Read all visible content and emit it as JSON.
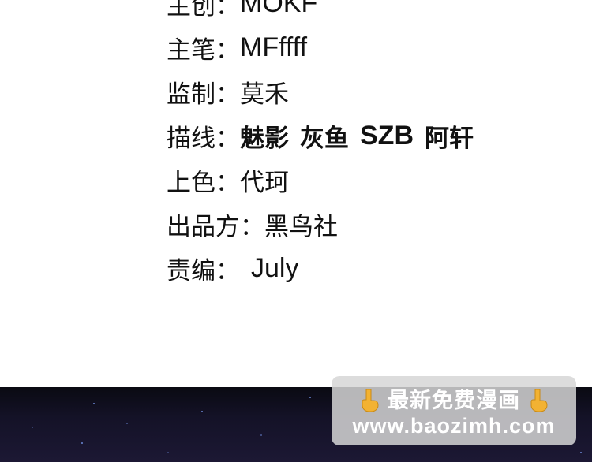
{
  "credits": [
    {
      "label": "主创：",
      "values": [
        "MOKF"
      ]
    },
    {
      "label": "主笔：",
      "values": [
        "MFffff"
      ]
    },
    {
      "label": "监制：",
      "values": [
        "莫禾"
      ]
    },
    {
      "label": "描线：",
      "values": [
        "魅影",
        "灰鱼",
        "SZB",
        "阿轩"
      ]
    },
    {
      "label": "上色：",
      "values": [
        "代珂"
      ]
    },
    {
      "label": "出品方：",
      "values": [
        "黑鸟社"
      ]
    },
    {
      "label": "责编：",
      "values": [
        "July"
      ]
    }
  ],
  "watermark": {
    "line1": "最新免费漫画",
    "line2": "www.baozimh.com",
    "icon_left": "pointing-down-hand-icon",
    "icon_right": "pointing-down-hand-icon"
  },
  "colors": {
    "text": "#111111",
    "background": "#ffffff",
    "night": "#141227",
    "watermark_bg": "#d6d6d6",
    "hand": "#f2b233"
  }
}
